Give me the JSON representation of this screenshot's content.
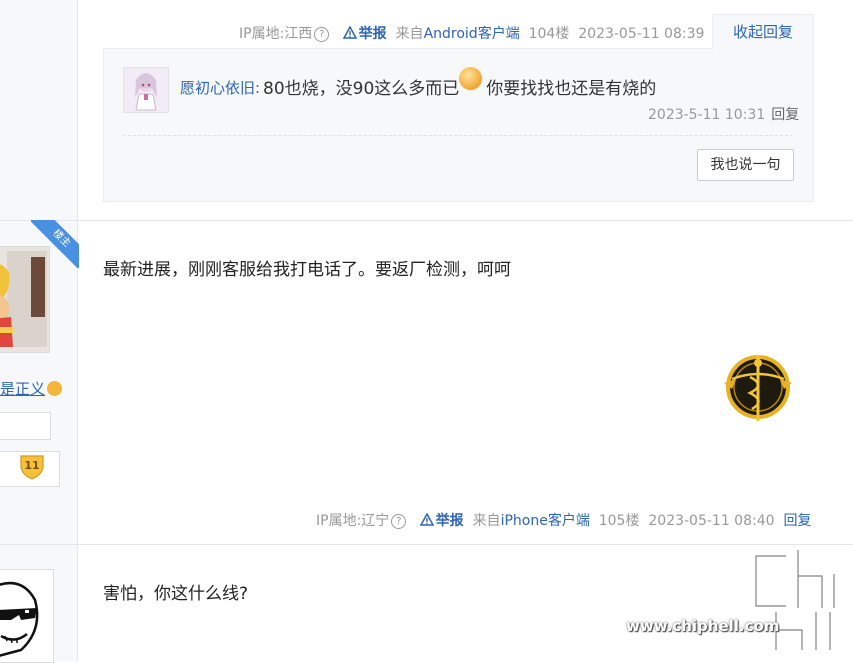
{
  "prev_post": {
    "ip_label": "IP属地:江西",
    "report_label": "举报",
    "source_prefix": "来自",
    "source_client": "Android客户端",
    "floor": "104楼",
    "time": "2023-05-11 08:39",
    "fold_label": "收起回复"
  },
  "sub_reply": {
    "user": "愿初心依旧:",
    "text_before": "80也烧，没90这么多而已",
    "text_after": "你要找找也还是有烧的",
    "time": "2023-5-11 10:31",
    "reply_label": "回复",
    "say_button": "我也说一句"
  },
  "main_post": {
    "owner_badge": "楼主",
    "text": "最新进展，刚刚客服给我打电话了。要返厂检测，呵呵",
    "user_fragment": "是正义",
    "level": "11",
    "ip_label": "IP属地:辽宁",
    "report_label": "举报",
    "source_prefix": "来自",
    "source_client": "iPhone客户端",
    "floor": "105楼",
    "time": "2023-05-11 08:40",
    "reply_label": "回复"
  },
  "next_post": {
    "text": "害怕，你这什么线?"
  },
  "watermark": {
    "url": "www.chiphell.com"
  },
  "colors": {
    "link": "#2d64b3",
    "meta": "#999999",
    "owner_badge": "#4a90e2"
  }
}
